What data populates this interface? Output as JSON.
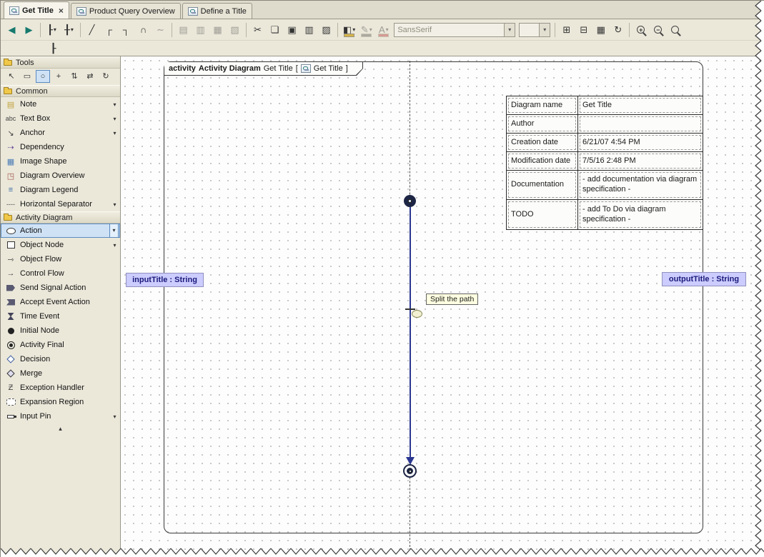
{
  "ui": {
    "close": "×",
    "caret": "▾",
    "scroll_up": "▴"
  },
  "colors": {
    "selection": "#2a3690",
    "pin_fill": "#ccccff",
    "palette_highlight": "#cfe2f5",
    "tooltip_bg": "#ffffe1"
  },
  "tabs": [
    {
      "label": "Get Title",
      "active": true,
      "closable": true
    },
    {
      "label": "Product Query Overview",
      "active": false
    },
    {
      "label": "Define a Title",
      "active": false
    }
  ],
  "toolbar": {
    "items": [
      {
        "type": "btn",
        "name": "back-button",
        "glyph": "◀",
        "color": "#177a6e"
      },
      {
        "type": "btn",
        "name": "forward-button",
        "glyph": "▶",
        "color": "#177a6e"
      },
      {
        "type": "sep"
      },
      {
        "type": "btn",
        "name": "layout-hierarchy-button",
        "glyph": "┠",
        "caret": true
      },
      {
        "type": "btn",
        "name": "route-paths-button",
        "glyph": "╂",
        "caret": true
      },
      {
        "type": "sep"
      },
      {
        "type": "btn",
        "name": "oblique-path-button",
        "glyph": "╱"
      },
      {
        "type": "btn",
        "name": "rectilinear-path-button",
        "glyph": "┌"
      },
      {
        "type": "btn",
        "name": "rounded-path-button",
        "glyph": "┐"
      },
      {
        "type": "btn",
        "name": "bezier-path-button",
        "glyph": "∩"
      },
      {
        "type": "btn",
        "name": "spline-path-button",
        "glyph": "∼",
        "disabled": true
      },
      {
        "type": "sep"
      },
      {
        "type": "btn",
        "name": "distribute-horizontally-button",
        "glyph": "▤",
        "disabled": true
      },
      {
        "type": "btn",
        "name": "distribute-vertically-button",
        "glyph": "▥",
        "disabled": true
      },
      {
        "type": "btn",
        "name": "make-same-width-button",
        "glyph": "▦",
        "disabled": true
      },
      {
        "type": "btn",
        "name": "make-same-height-button",
        "glyph": "▧",
        "disabled": true
      },
      {
        "type": "sep"
      },
      {
        "type": "btn",
        "name": "cut-button",
        "glyph": "✂"
      },
      {
        "type": "btn",
        "name": "copy-button",
        "glyph": "❏"
      },
      {
        "type": "btn",
        "name": "paste-button",
        "glyph": "▣"
      },
      {
        "type": "btn",
        "name": "paste-with-style-button",
        "glyph": "▥"
      },
      {
        "type": "btn",
        "name": "clone-button",
        "glyph": "▨"
      },
      {
        "type": "sep"
      },
      {
        "type": "btn",
        "name": "fill-color-button",
        "glyph": "◧",
        "caret": true,
        "colorbar": "#d4b24a"
      },
      {
        "type": "btn",
        "name": "line-color-button",
        "glyph": "✎",
        "caret": true,
        "colorbar": "#555555",
        "disabled": true
      },
      {
        "type": "btn",
        "name": "font-color-button",
        "glyph": "A",
        "caret": true,
        "colorbar": "#bb3333",
        "disabled": true
      },
      {
        "type": "combo",
        "name": "font-name-combo",
        "value": "SansSerif",
        "width": 170,
        "disabled": true
      },
      {
        "type": "combo",
        "name": "font-size-combo",
        "value": "",
        "width": 44,
        "disabled": true
      },
      {
        "type": "sep"
      },
      {
        "type": "btn",
        "name": "insert-table-button",
        "glyph": "⊞"
      },
      {
        "type": "btn",
        "name": "insert-row-button",
        "glyph": "⊟"
      },
      {
        "type": "btn",
        "name": "diagram-properties-button",
        "glyph": "▦"
      },
      {
        "type": "btn",
        "name": "refresh-button",
        "glyph": "↻"
      },
      {
        "type": "sep"
      },
      {
        "type": "btn",
        "name": "zoom-in-button",
        "mag": true,
        "sign": "+"
      },
      {
        "type": "btn",
        "name": "zoom-out-button",
        "mag": true,
        "sign": "−"
      },
      {
        "type": "btn",
        "name": "fit-in-window-button",
        "mag": true,
        "sign": ""
      }
    ]
  },
  "toolbar2": {
    "items": [
      {
        "type": "btn",
        "name": "select-in-containment-tree-button",
        "glyph": "┠"
      }
    ]
  },
  "palette": {
    "sections": [
      {
        "label": "Tools",
        "tools": [
          {
            "name": "select-tool",
            "glyph": "↖"
          },
          {
            "name": "marquee-tool",
            "glyph": "▭"
          },
          {
            "name": "sticky-tool",
            "glyph": "○",
            "selected": true
          },
          {
            "name": "add-tool",
            "glyph": "+"
          },
          {
            "name": "distribute-tool",
            "glyph": "⇅"
          },
          {
            "name": "order-tool",
            "glyph": "⇄"
          },
          {
            "name": "transform-tool",
            "glyph": "↻"
          }
        ]
      },
      {
        "label": "Common",
        "items": [
          {
            "label": "Note",
            "glyph": "▤",
            "iconColor": "#c2a23c",
            "dropdown": true
          },
          {
            "label": "Text Box",
            "iconText": "abc",
            "dropdown": true
          },
          {
            "label": "Anchor",
            "glyph": "↘",
            "dropdown": true
          },
          {
            "label": "Dependency",
            "glyph": "⇢",
            "iconColor": "#6a4a9a"
          },
          {
            "label": "Image Shape",
            "glyph": "▦",
            "iconColor": "#4a7ab5"
          },
          {
            "label": "Diagram Overview",
            "glyph": "◳",
            "iconColor": "#a0524a"
          },
          {
            "label": "Diagram Legend",
            "glyph": "≡",
            "iconColor": "#3a6aa0"
          },
          {
            "label": "Horizontal Separator",
            "iconText": "----",
            "dropdown": true
          }
        ]
      },
      {
        "label": "Activity Diagram",
        "items": [
          {
            "label": "Action",
            "shape": "oval",
            "dropdown": true,
            "selected": true
          },
          {
            "label": "Object Node",
            "shape": "rect",
            "dropdown": true
          },
          {
            "label": "Object Flow",
            "glyph": "⇾"
          },
          {
            "label": "Control Flow",
            "glyph": "→"
          },
          {
            "label": "Send Signal Action",
            "shape": "pentagon"
          },
          {
            "label": "Accept Event Action",
            "shape": "concave"
          },
          {
            "label": "Time Event",
            "shape": "hourglass"
          },
          {
            "label": "Initial Node",
            "shape": "dot"
          },
          {
            "label": "Activity Final",
            "shape": "ring"
          },
          {
            "label": "Decision",
            "shape": "diamond"
          },
          {
            "label": "Merge",
            "shape": "diamond2"
          },
          {
            "label": "Exception Handler",
            "glyph": "Ƶ"
          },
          {
            "label": "Expansion Region",
            "shape": "dashed-rect"
          },
          {
            "label": "Input Pin",
            "shape": "pin",
            "dropdown": true
          }
        ]
      }
    ]
  },
  "canvas": {
    "frame": {
      "keyword": "activity",
      "type": "Activity Diagram",
      "name": "Get Title",
      "open": "[",
      "ref": "Get Title",
      "close": "]"
    },
    "info_table": {
      "rows": [
        {
          "label": "Diagram name",
          "value": "Get Title"
        },
        {
          "label": "Author",
          "value": ""
        },
        {
          "label": "Creation date",
          "value": "6/21/07 4:54 PM"
        },
        {
          "label": "Modification date",
          "value": "7/5/16 2:48 PM"
        },
        {
          "label": "Documentation",
          "value": "- add documentation via diagram specification -",
          "tall": true
        },
        {
          "label": "TODO",
          "value": "- add To Do via diagram specification -",
          "tall": true
        }
      ]
    },
    "input_pin_label": "inputTitle : String",
    "output_pin_label": "outputTitle : String",
    "tooltip": "Split the path"
  }
}
